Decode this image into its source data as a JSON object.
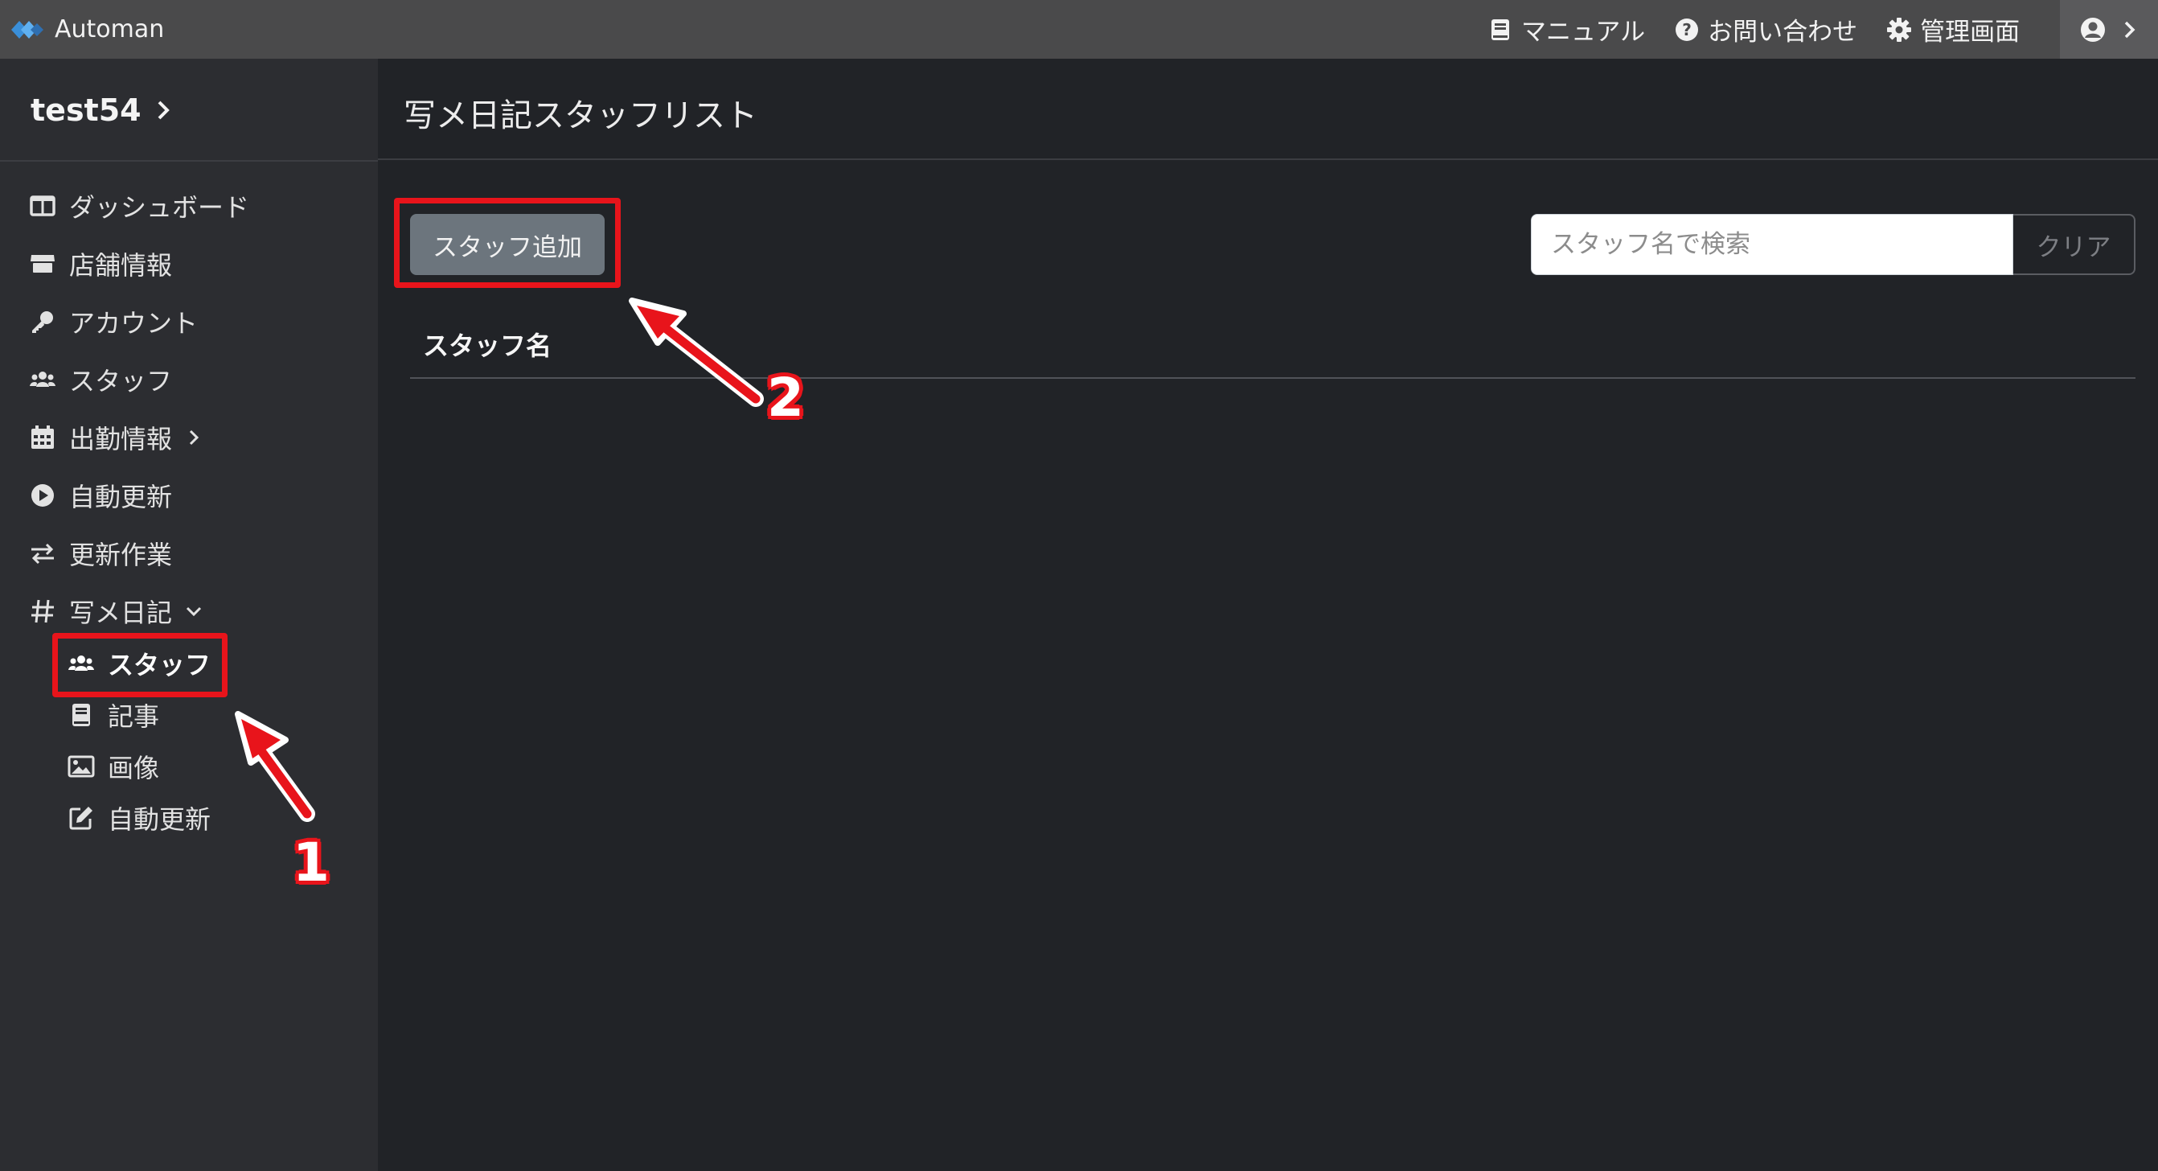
{
  "app": {
    "name": "Automan"
  },
  "topnav": {
    "manual": "マニュアル",
    "contact": "お問い合わせ",
    "admin": "管理画面"
  },
  "sidebar": {
    "site_name": "test54",
    "items": [
      {
        "label": "ダッシュボード",
        "icon": "dashboard-icon"
      },
      {
        "label": "店舗情報",
        "icon": "store-icon"
      },
      {
        "label": "アカウント",
        "icon": "key-icon"
      },
      {
        "label": "スタッフ",
        "icon": "users-icon"
      },
      {
        "label": "出勤情報",
        "icon": "calendar-icon"
      },
      {
        "label": "自動更新",
        "icon": "play-circle-icon"
      },
      {
        "label": "更新作業",
        "icon": "exchange-icon"
      },
      {
        "label": "写メ日記",
        "icon": "hashtag-icon"
      }
    ],
    "diary_sub": [
      {
        "label": "スタッフ",
        "icon": "users-icon",
        "active": true
      },
      {
        "label": "記事",
        "icon": "book-icon"
      },
      {
        "label": "画像",
        "icon": "image-icon"
      },
      {
        "label": "自動更新",
        "icon": "edit-icon"
      }
    ]
  },
  "main": {
    "title": "写メ日記スタッフリスト",
    "add_button": "スタッフ追加",
    "search_placeholder": "スタッフ名で検索",
    "clear_button": "クリア",
    "column_header": "スタッフ名"
  },
  "annotations": {
    "step1": "1",
    "step2": "2",
    "color": "#e8141b"
  },
  "colors": {
    "topbar": "#4a4a4b",
    "sidebar": "#2c2d31",
    "background": "#212327",
    "button": "#6c757d"
  }
}
